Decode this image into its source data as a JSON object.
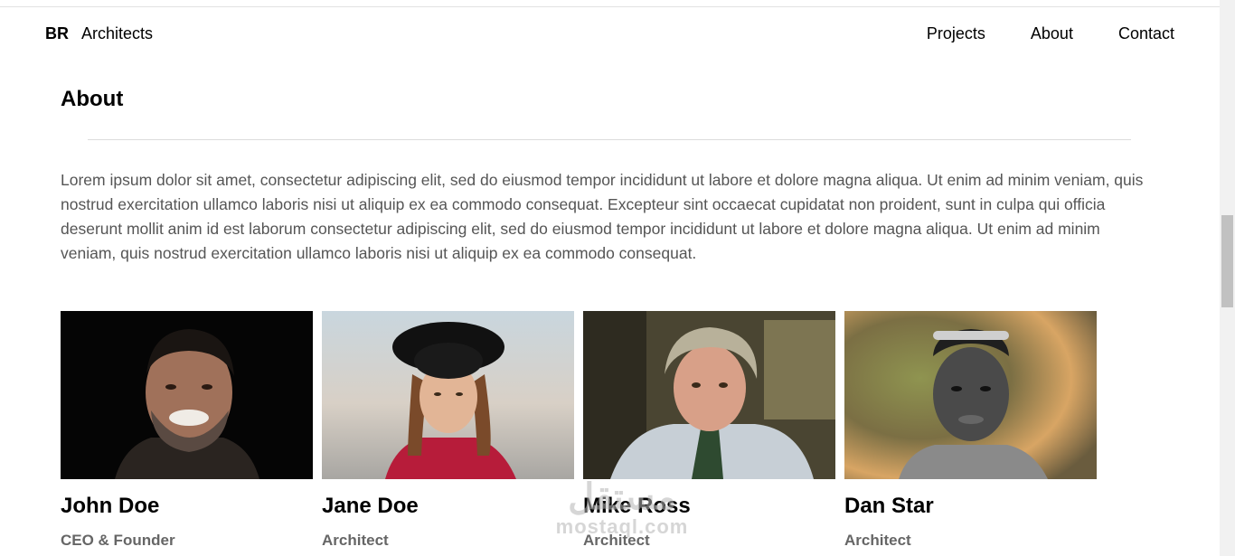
{
  "nav": {
    "brand_bold": "BR",
    "brand_name": "Architects",
    "links": [
      "Projects",
      "About",
      "Contact"
    ]
  },
  "about": {
    "title": "About",
    "text": "Lorem ipsum dolor sit amet, consectetur adipiscing elit, sed do eiusmod tempor incididunt ut labore et dolore magna aliqua. Ut enim ad minim veniam, quis nostrud exercitation ullamco laboris nisi ut aliquip ex ea commodo consequat. Excepteur sint occaecat cupidatat non proident, sunt in culpa qui officia deserunt mollit anim id est laborum consectetur adipiscing elit, sed do eiusmod tempor incididunt ut labore et dolore magna aliqua. Ut enim ad minim veniam, quis nostrud exercitation ullamco laboris nisi ut aliquip ex ea commodo consequat."
  },
  "team": [
    {
      "name": "John Doe",
      "role": "CEO & Founder"
    },
    {
      "name": "Jane Doe",
      "role": "Architect"
    },
    {
      "name": "Mike Ross",
      "role": "Architect"
    },
    {
      "name": "Dan Star",
      "role": "Architect"
    }
  ],
  "watermark": {
    "arabic": "مستقل",
    "latin": "mostaql.com"
  }
}
